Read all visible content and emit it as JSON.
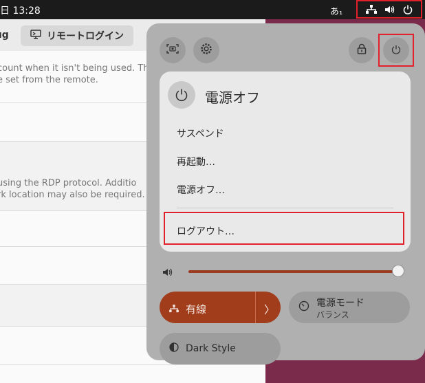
{
  "topbar": {
    "clock": "日 13:28",
    "ime": "あ₁",
    "tray_icons": [
      "network-icon",
      "volume-icon",
      "power-icon"
    ]
  },
  "background_window": {
    "header_left": "ıg",
    "remote_login_tab": "リモートログイン",
    "para1_line1": "count when it isn't being used. Th",
    "para1_line2": "e set from the remote.",
    "para2_line1": "using the RDP protocol. Additio",
    "para2_line2": "rk location may also be required."
  },
  "quick_settings": {
    "top_icons": [
      "screenshot-icon",
      "settings-icon",
      "lock-icon",
      "power-icon"
    ],
    "power_menu": {
      "title": "電源オフ",
      "items": [
        "サスペンド",
        "再起動…",
        "電源オフ…",
        "ログアウト…"
      ]
    },
    "volume": {
      "level": 1.0
    },
    "network_toggle": {
      "label": "有線",
      "active": true
    },
    "power_mode": {
      "title": "電源モード",
      "subtitle": "バランス"
    },
    "dark_style": {
      "label": "Dark Style"
    }
  },
  "colors": {
    "accent": "#a23d1b",
    "highlight": "#e0202a",
    "panel": "#b0b0b0"
  }
}
